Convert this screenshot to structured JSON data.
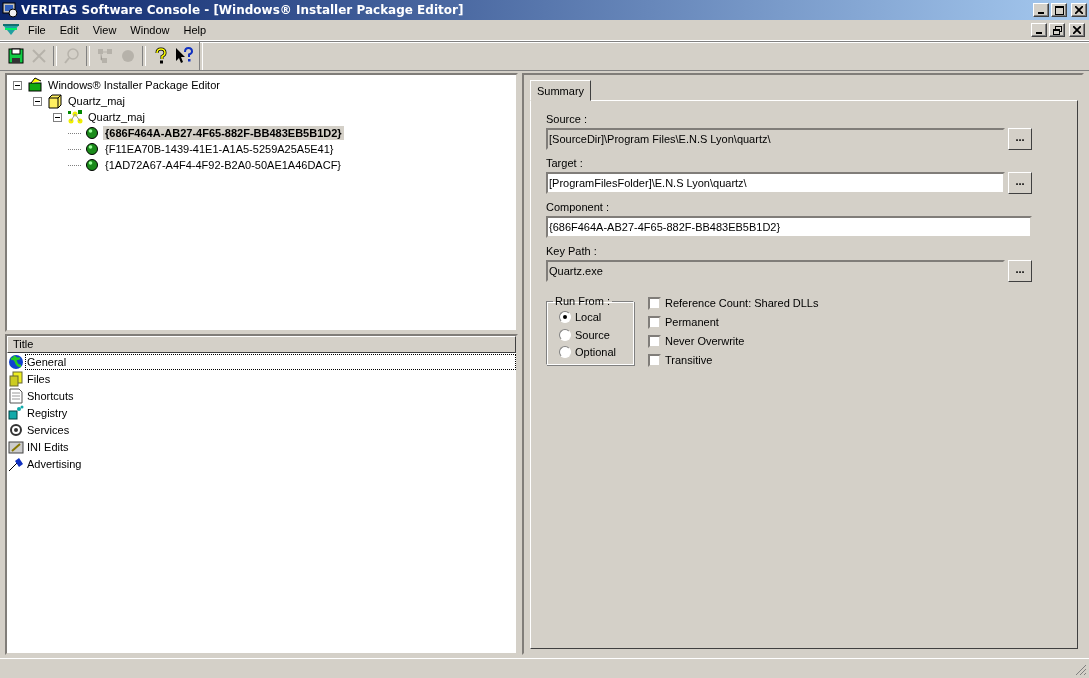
{
  "window": {
    "title": "VERITAS Software Console - [Windows® Installer Package Editor]"
  },
  "menu": [
    {
      "label": "File"
    },
    {
      "label": "Edit"
    },
    {
      "label": "View"
    },
    {
      "label": "Window"
    },
    {
      "label": "Help"
    }
  ],
  "toolbar": [
    {
      "kind": "save",
      "disabled": false
    },
    {
      "kind": "delete",
      "disabled": true
    },
    {
      "kind": "separator"
    },
    {
      "kind": "find",
      "disabled": true
    },
    {
      "kind": "separator"
    },
    {
      "kind": "tree",
      "disabled": true
    },
    {
      "kind": "ball",
      "disabled": true
    },
    {
      "kind": "separator"
    },
    {
      "kind": "help",
      "disabled": false
    },
    {
      "kind": "whats-this",
      "disabled": false
    }
  ],
  "tree": [
    {
      "label": "Windows® Installer Package Editor",
      "kind": "root",
      "expanded": true,
      "children": [
        {
          "label": "Quartz_maj",
          "kind": "product",
          "expanded": true,
          "children": [
            {
              "label": "Quartz_maj",
              "kind": "feature",
              "expanded": true,
              "children": [
                {
                  "label": "{686F464A-AB27-4F65-882F-BB483EB5B1D2}",
                  "kind": "component",
                  "selected": true
                },
                {
                  "label": "{F11EA70B-1439-41E1-A1A5-5259A25A5E41}",
                  "kind": "component",
                  "selected": false
                },
                {
                  "label": "{1AD72A67-A4F4-4F92-B2A0-50AE1A46DACF}",
                  "kind": "component",
                  "selected": false
                }
              ]
            }
          ]
        }
      ]
    }
  ],
  "list": {
    "column": "Title",
    "items": [
      {
        "label": "General",
        "kind": "general",
        "selected": true
      },
      {
        "label": "Files",
        "kind": "files",
        "selected": false
      },
      {
        "label": "Shortcuts",
        "kind": "shortcuts",
        "selected": false
      },
      {
        "label": "Registry",
        "kind": "registry",
        "selected": false
      },
      {
        "label": "Services",
        "kind": "services",
        "selected": false
      },
      {
        "label": "INI Edits",
        "kind": "ini",
        "selected": false
      },
      {
        "label": "Advertising",
        "kind": "advertising",
        "selected": false
      }
    ]
  },
  "summary": {
    "tabs": [
      {
        "label": "Summary",
        "selected": true
      }
    ],
    "fields": [
      {
        "label": "Source :",
        "value": "[SourceDir]\\Program Files\\E.N.S Lyon\\quartz\\",
        "disabled": true,
        "browse": "..."
      },
      {
        "label": "Target :",
        "value": "[ProgramFilesFolder]\\E.N.S Lyon\\quartz\\",
        "disabled": false,
        "browse": "..."
      },
      {
        "label": "Component :",
        "value": "{686F464A-AB27-4F65-882F-BB483EB5B1D2}",
        "disabled": false
      },
      {
        "label": "Key Path :",
        "value": "Quartz.exe",
        "disabled": true,
        "browse": "..."
      }
    ],
    "run_from": {
      "title": "Run From :",
      "options": [
        {
          "label": "Local",
          "selected": true
        },
        {
          "label": "Source",
          "selected": false
        },
        {
          "label": "Optional",
          "selected": false
        }
      ]
    },
    "options": [
      {
        "label": "Reference Count: Shared DLLs",
        "checked": false
      },
      {
        "label": "Permanent",
        "checked": false
      },
      {
        "label": "Never Overwrite",
        "checked": false
      },
      {
        "label": "Transitive",
        "checked": false
      }
    ]
  }
}
